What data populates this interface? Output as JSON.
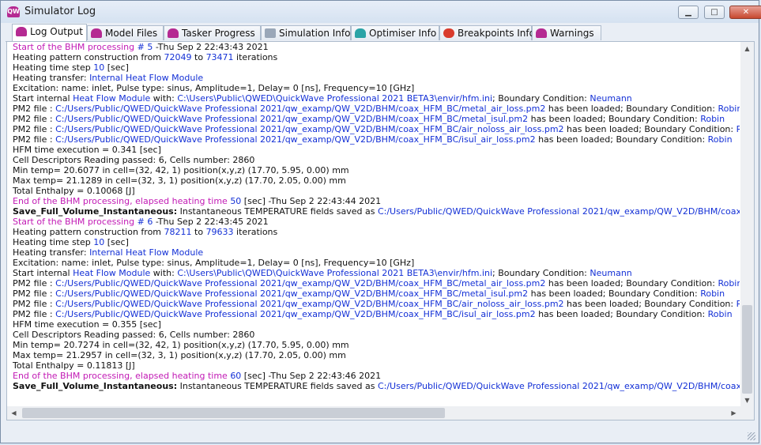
{
  "window": {
    "title": "Simulator Log",
    "app_icon_text": "QW"
  },
  "controls": {
    "minimize": "▁",
    "maximize": "□",
    "close": "✕"
  },
  "tabs": [
    {
      "label": "Log Output",
      "active": true,
      "icon": "qw-logo-icon"
    },
    {
      "label": "Model Files",
      "icon": "qw-logo-icon"
    },
    {
      "label": "Tasker Progress",
      "icon": "qw-logo-icon"
    },
    {
      "label": "Simulation Info",
      "icon": "document-icon"
    },
    {
      "label": "Optimiser Info",
      "icon": "optimiser-icon"
    },
    {
      "label": "Breakpoints Info",
      "icon": "breakpoint-icon"
    },
    {
      "label": "Warnings",
      "icon": "qw-logo-icon"
    }
  ],
  "log": {
    "lines": [
      [
        {
          "t": "Start of the BHM processing",
          "c": "m"
        },
        {
          "t": " # 5 ",
          "c": "b"
        },
        {
          "t": "-Thu Sep 2 22:43:43 2021"
        }
      ],
      [
        {
          "t": "Heating pattern construction from "
        },
        {
          "t": "72049",
          "c": "b"
        },
        {
          "t": " to "
        },
        {
          "t": "73471",
          "c": "b"
        },
        {
          "t": " iterations"
        }
      ],
      [
        {
          "t": "Heating time step "
        },
        {
          "t": "10",
          "c": "b"
        },
        {
          "t": " [sec]"
        }
      ],
      [
        {
          "t": "Heating transfer: "
        },
        {
          "t": "Internal Heat Flow Module",
          "c": "b"
        }
      ],
      [
        {
          "t": "Excitation: name: inlet, Pulse type: sinus, Amplitude=1, Delay= 0 [ns], Frequency=10 [GHz]"
        }
      ],
      [
        {
          "t": "Start internal "
        },
        {
          "t": "Heat Flow Module",
          "c": "b"
        },
        {
          "t": " with: "
        },
        {
          "t": "C:\\Users\\Public\\QWED\\QuickWave Professional 2021 BETA3\\envir/hfm.ini",
          "c": "b"
        },
        {
          "t": "; Boundary Condition: "
        },
        {
          "t": "Neumann",
          "c": "b"
        }
      ],
      [
        {
          "t": "PM2 file : "
        },
        {
          "t": "C:/Users/Public/QWED/QuickWave Professional 2021/qw_examp/QW_V2D/BHM/coax_HFM_BC/metal_air_loss.pm2",
          "c": "b"
        },
        {
          "t": " has been loaded; Boundary Condition: "
        },
        {
          "t": "Robin",
          "c": "b"
        }
      ],
      [
        {
          "t": "PM2 file : "
        },
        {
          "t": "C:/Users/Public/QWED/QuickWave Professional 2021/qw_examp/QW_V2D/BHM/coax_HFM_BC/metal_isul.pm2",
          "c": "b"
        },
        {
          "t": " has been loaded; Boundary Condition: "
        },
        {
          "t": "Robin",
          "c": "b"
        }
      ],
      [
        {
          "t": "PM2 file : "
        },
        {
          "t": "C:/Users/Public/QWED/QuickWave Professional 2021/qw_examp/QW_V2D/BHM/coax_HFM_BC/air_noloss_air_loss.pm2",
          "c": "b"
        },
        {
          "t": " has been loaded; Boundary Condition: "
        },
        {
          "t": "Robin",
          "c": "b"
        }
      ],
      [
        {
          "t": "PM2 file : "
        },
        {
          "t": "C:/Users/Public/QWED/QuickWave Professional 2021/qw_examp/QW_V2D/BHM/coax_HFM_BC/isul_air_loss.pm2",
          "c": "b"
        },
        {
          "t": " has been loaded; Boundary Condition: "
        },
        {
          "t": "Robin",
          "c": "b"
        }
      ],
      [
        {
          "t": "HFM time execution = 0.341 [sec]"
        }
      ],
      [
        {
          "t": "Cell Descriptors Reading passed: 6, Cells number: 2860"
        }
      ],
      [
        {
          "t": "Min temp= 20.6077 in cell=(32, 42, 1) position(x,y,z) (17.70, 5.95, 0.00) mm"
        }
      ],
      [
        {
          "t": "Max temp= 21.1289 in cell=(32, 3, 1) position(x,y,z) (17.70, 2.05, 0.00) mm"
        }
      ],
      [
        {
          "t": "Total Enthalpy = 0.10068 [J]"
        }
      ],
      [
        {
          "t": "End of the BHM processing, elapsed heating time ",
          "c": "m"
        },
        {
          "t": "50",
          "c": "b"
        },
        {
          "t": " [sec] -Thu Sep 2 22:43:44 2021"
        }
      ],
      [
        {
          "t": "Save_Full_Volume_Instantaneous:",
          "c": "bold"
        },
        {
          "t": " Instantaneous TEMPERATURE fields saved as "
        },
        {
          "t": "C:/Users/Public/QWED/QuickWave Professional 2021/qw_examp/QW_V2D/BHM/coax_HFM_BC/coax_pe",
          "c": "b"
        }
      ],
      [
        {
          "t": "Start of the BHM processing",
          "c": "m"
        },
        {
          "t": " # 6 ",
          "c": "b"
        },
        {
          "t": "-Thu Sep 2 22:43:45 2021"
        }
      ],
      [
        {
          "t": "Heating pattern construction from "
        },
        {
          "t": "78211",
          "c": "b"
        },
        {
          "t": " to "
        },
        {
          "t": "79633",
          "c": "b"
        },
        {
          "t": " iterations"
        }
      ],
      [
        {
          "t": "Heating time step "
        },
        {
          "t": "10",
          "c": "b"
        },
        {
          "t": " [sec]"
        }
      ],
      [
        {
          "t": "Heating transfer: "
        },
        {
          "t": "Internal Heat Flow Module",
          "c": "b"
        }
      ],
      [
        {
          "t": "Excitation: name: inlet, Pulse type: sinus, Amplitude=1, Delay= 0 [ns], Frequency=10 [GHz]"
        }
      ],
      [
        {
          "t": "Start internal "
        },
        {
          "t": "Heat Flow Module",
          "c": "b"
        },
        {
          "t": " with: "
        },
        {
          "t": "C:\\Users\\Public\\QWED\\QuickWave Professional 2021 BETA3\\envir/hfm.ini",
          "c": "b"
        },
        {
          "t": "; Boundary Condition: "
        },
        {
          "t": "Neumann",
          "c": "b"
        }
      ],
      [
        {
          "t": "PM2 file : "
        },
        {
          "t": "C:/Users/Public/QWED/QuickWave Professional 2021/qw_examp/QW_V2D/BHM/coax_HFM_BC/metal_air_loss.pm2",
          "c": "b"
        },
        {
          "t": " has been loaded; Boundary Condition: "
        },
        {
          "t": "Robin",
          "c": "b"
        }
      ],
      [
        {
          "t": "PM2 file : "
        },
        {
          "t": "C:/Users/Public/QWED/QuickWave Professional 2021/qw_examp/QW_V2D/BHM/coax_HFM_BC/metal_isul.pm2",
          "c": "b"
        },
        {
          "t": " has been loaded; Boundary Condition: "
        },
        {
          "t": "Robin",
          "c": "b"
        }
      ],
      [
        {
          "t": "PM2 file : "
        },
        {
          "t": "C:/Users/Public/QWED/QuickWave Professional 2021/qw_examp/QW_V2D/BHM/coax_HFM_BC/air_noloss_air_loss.pm2",
          "c": "b"
        },
        {
          "t": " has been loaded; Boundary Condition: "
        },
        {
          "t": "Robin",
          "c": "b"
        }
      ],
      [
        {
          "t": "PM2 file : "
        },
        {
          "t": "C:/Users/Public/QWED/QuickWave Professional 2021/qw_examp/QW_V2D/BHM/coax_HFM_BC/isul_air_loss.pm2",
          "c": "b"
        },
        {
          "t": " has been loaded; Boundary Condition: "
        },
        {
          "t": "Robin",
          "c": "b"
        }
      ],
      [
        {
          "t": "HFM time execution = 0.355 [sec]"
        }
      ],
      [
        {
          "t": "Cell Descriptors Reading passed: 6, Cells number: 2860"
        }
      ],
      [
        {
          "t": "Min temp= 20.7274 in cell=(32, 42, 1) position(x,y,z) (17.70, 5.95, 0.00) mm"
        }
      ],
      [
        {
          "t": "Max temp= 21.2957 in cell=(32, 3, 1) position(x,y,z) (17.70, 2.05, 0.00) mm"
        }
      ],
      [
        {
          "t": "Total Enthalpy = 0.11813 [J]"
        }
      ],
      [
        {
          "t": "End of the BHM processing, elapsed heating time ",
          "c": "m"
        },
        {
          "t": "60",
          "c": "b"
        },
        {
          "t": " [sec] -Thu Sep 2 22:43:46 2021"
        }
      ],
      [
        {
          "t": "Save_Full_Volume_Instantaneous:",
          "c": "bold"
        },
        {
          "t": " Instantaneous TEMPERATURE fields saved as "
        },
        {
          "t": "C:/Users/Public/QWED/QuickWave Professional 2021/qw_examp/QW_V2D/BHM/coax_HFM_BC/coax_pe",
          "c": "b"
        }
      ]
    ]
  },
  "colors": {
    "magenta": "#c21ab5",
    "blue": "#1330d6",
    "qw_brand": "#b52a92"
  }
}
